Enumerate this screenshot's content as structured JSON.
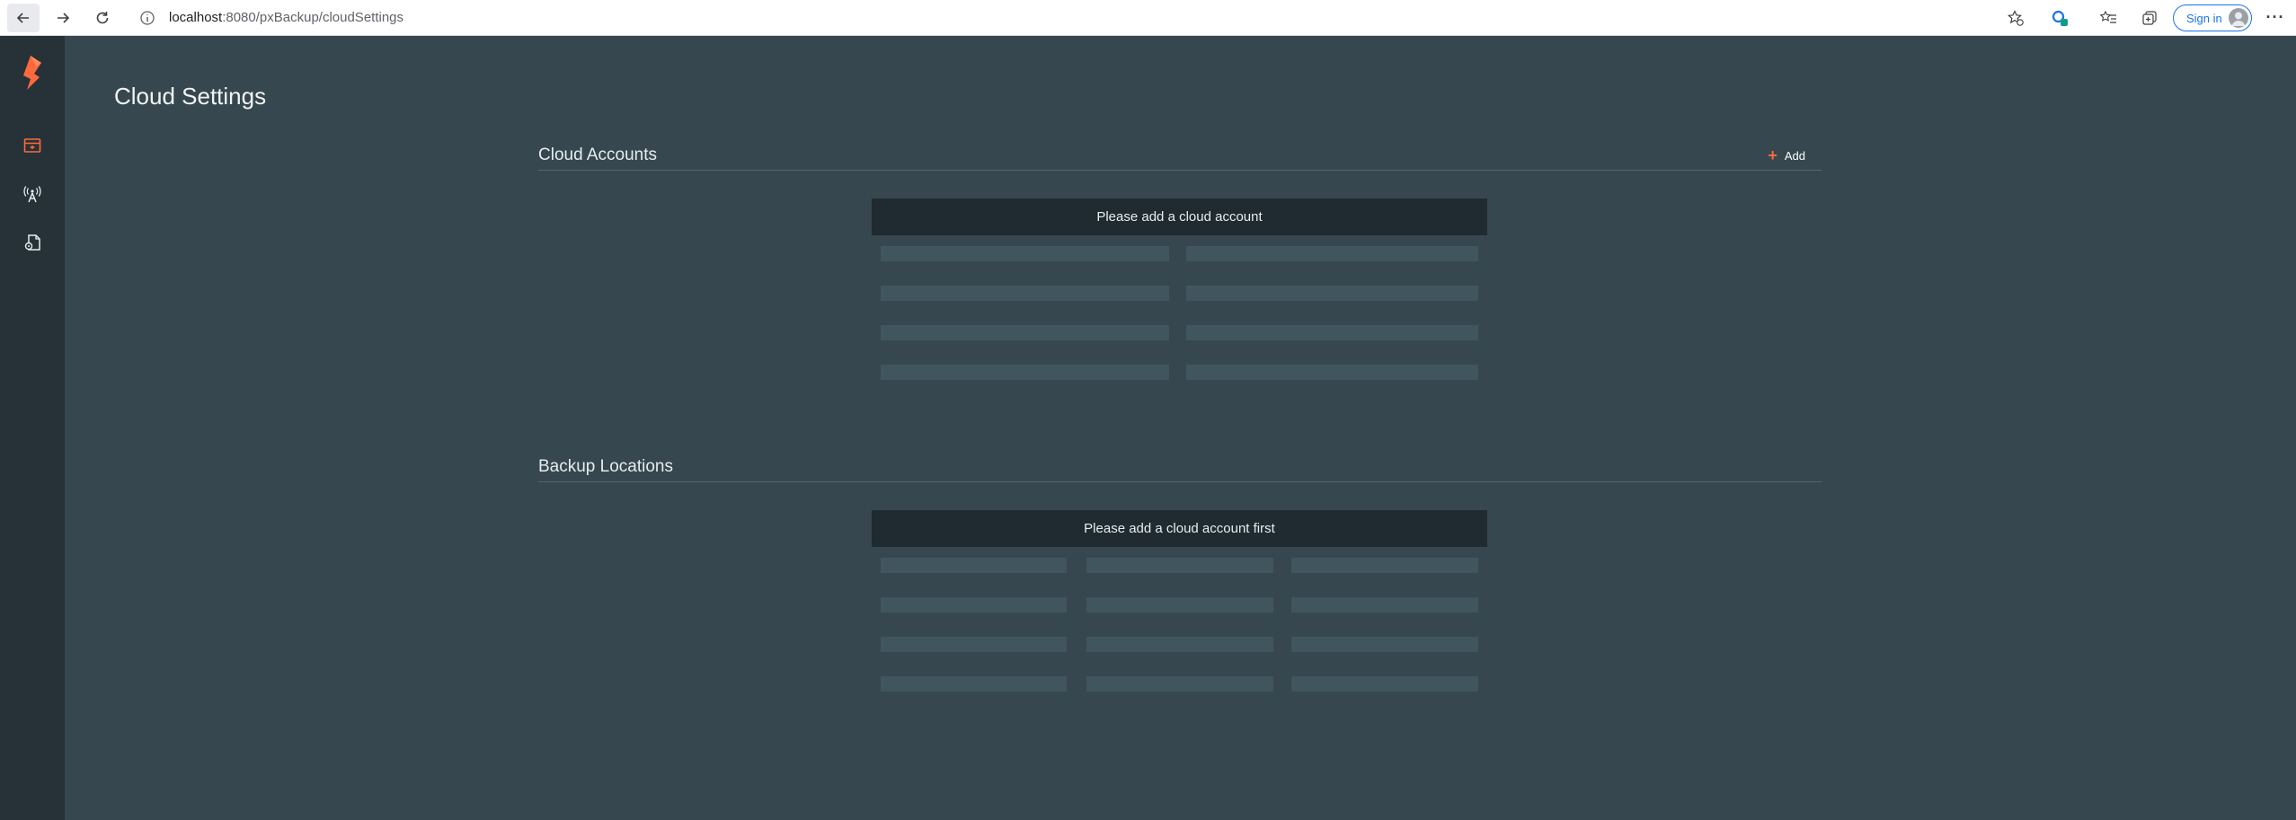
{
  "browser": {
    "url_host": "localhost",
    "url_path": ":8080/pxBackup/cloudSettings",
    "signin_label": "Sign in"
  },
  "rail": {
    "items": [
      {
        "icon": "cloud-settings-icon"
      },
      {
        "icon": "antenna-icon"
      },
      {
        "icon": "document-settings-icon"
      }
    ],
    "accent": "#ff6a3d"
  },
  "page": {
    "title": "Cloud Settings"
  },
  "cloud_accounts": {
    "title": "Cloud Accounts",
    "add_label": "Add",
    "empty_message": "Please add a cloud account"
  },
  "backup_locations": {
    "title": "Backup Locations",
    "empty_message": "Please add a cloud account first"
  }
}
